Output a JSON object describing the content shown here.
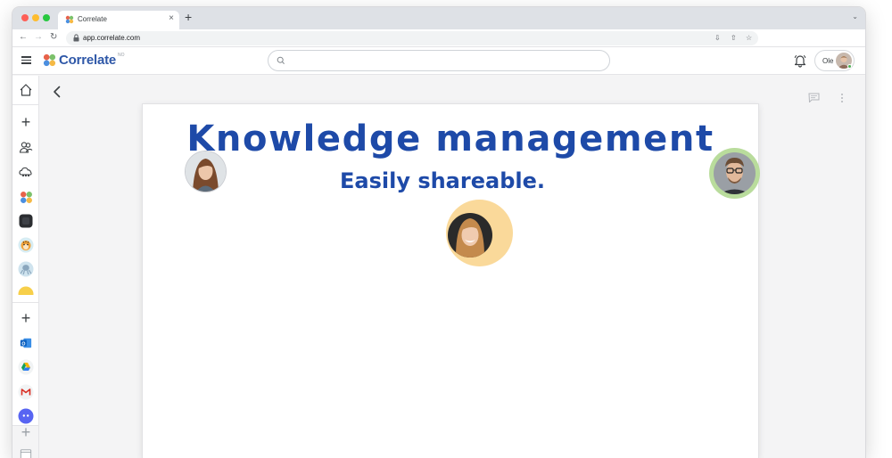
{
  "browser": {
    "tab_title": "Correlate",
    "tab_close": "×",
    "new_tab": "+",
    "tab_menu": "⌄",
    "url": "app.correlate.com",
    "nav": {
      "back": "←",
      "forward": "→",
      "reload": "↻"
    },
    "omnibox_icons": {
      "install": "⇩",
      "share": "⇧",
      "bookmark": "☆"
    }
  },
  "app": {
    "logo_text": "Correlate",
    "logo_sup": "NO",
    "search": {
      "placeholder": ""
    },
    "user": {
      "name": "Ole"
    }
  },
  "rail": {
    "items": [
      {
        "name": "home-icon"
      },
      {
        "name": "add-icon",
        "label": "+"
      },
      {
        "name": "people-icon"
      },
      {
        "name": "cloud-group-icon"
      },
      {
        "name": "correlate-workspace-icon"
      },
      {
        "name": "dark-workspace-icon"
      },
      {
        "name": "tiger-workspace-icon"
      },
      {
        "name": "octopus-workspace-icon"
      },
      {
        "name": "add-integration-icon",
        "label": "+"
      },
      {
        "name": "outlook-icon"
      },
      {
        "name": "google-drive-icon"
      },
      {
        "name": "gmail-icon"
      },
      {
        "name": "discord-icon"
      },
      {
        "name": "add-more-icon",
        "label": "+"
      }
    ]
  },
  "document": {
    "headline": "Knowledge management",
    "subline": "Easily shareable."
  },
  "colors": {
    "brand": "#1e4aa8",
    "logo_blue": "#2f58a8",
    "ring_green": "#b9dc9c",
    "ring_orange": "#fad99a"
  }
}
